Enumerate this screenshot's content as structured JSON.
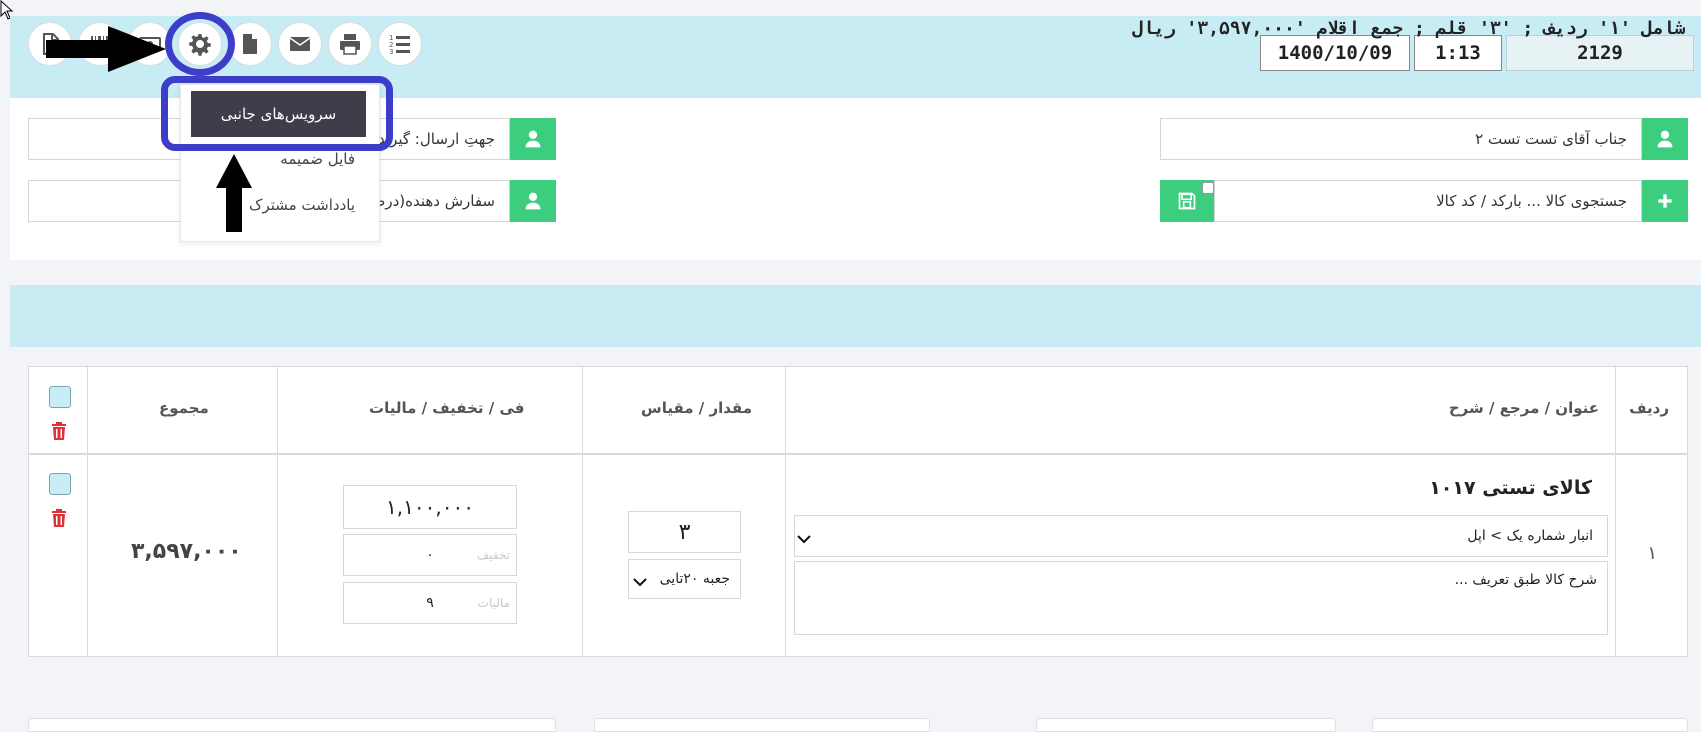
{
  "toolbar": {
    "icons": [
      "report-icon",
      "barcode-icon",
      "cash-icon",
      "gear-icon",
      "file-icon",
      "envelope-icon",
      "printer-icon",
      "list-numbered-icon"
    ],
    "date": "1400/10/09",
    "time": "1:13",
    "number": "2129"
  },
  "settings_menu": {
    "items": [
      "سرویس‌های جانبی",
      "فایل ضمیمه",
      "یادداشت مشترک"
    ]
  },
  "form": {
    "customer": "جناب آقای تست تست ۲",
    "product_search_placeholder": "جستجوی کالا ... بارکد / کد کالا",
    "send_direction": "جهتِ ارسال: گیرنده",
    "orderer": "سفارش دهنده(درص"
  },
  "summary": {
    "text": "شامل '۱' ردیف ; '۳' قلم ; جمع اقلام '۳,۵۹۷,۰۰۰' ریال"
  },
  "table": {
    "headers": {
      "row": "ردیف",
      "title": "عنوان / مرجع / شرح",
      "qty": "مقدار / مقیاس",
      "price": "فی / تخفیف / مالیات",
      "total": "مجموع"
    },
    "rows": [
      {
        "index": "۱",
        "product_name": "کالای تستی ۱۰۱۷",
        "warehouse": "انبار شماره یک > اپل",
        "description": "شرح کالا طبق تعریف ...",
        "quantity": "۳",
        "unit": "جعبه ۲۰تایی",
        "price": "۱,۱۰۰,۰۰۰",
        "discount_label": "تخفیف",
        "discount": "۰",
        "tax_label": "مالیات",
        "tax": "۹",
        "total": "۳,۵۹۷,۰۰۰"
      }
    ]
  },
  "colors": {
    "header_band": "#c8ecf4",
    "green": "#3ccd7e",
    "highlight_ring": "#3c3dc9",
    "menu_active": "#3e3d49",
    "trash_red": "#e0303a"
  }
}
